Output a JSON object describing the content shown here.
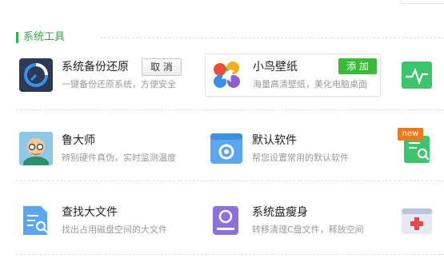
{
  "section": {
    "title": "系统工具"
  },
  "items": [
    {
      "title": "系统备份还原",
      "desc": "一键备份还原系统，方便安全",
      "button": "取 消"
    },
    {
      "title": "小鸟壁纸",
      "desc": "海量高清壁纸，美化电脑桌面",
      "button": "添 加"
    },
    {
      "title": "",
      "desc": ""
    },
    {
      "title": "鲁大师",
      "desc": "辨别硬件真伪，实时监测温度"
    },
    {
      "title": "默认软件",
      "desc": "帮您设置常用的默认软件"
    },
    {
      "title": "",
      "desc": "",
      "badge": "new"
    },
    {
      "title": "查找大文件",
      "desc": "找出占用磁盘空间的大文件"
    },
    {
      "title": "系统盘瘦身",
      "desc": "转移清理C盘文件，释放空间"
    },
    {
      "title": "",
      "desc": ""
    }
  ],
  "colors": {
    "accent": "#2fb94a",
    "add_button": "#3cbb3a",
    "badge": "#f07a1a"
  }
}
